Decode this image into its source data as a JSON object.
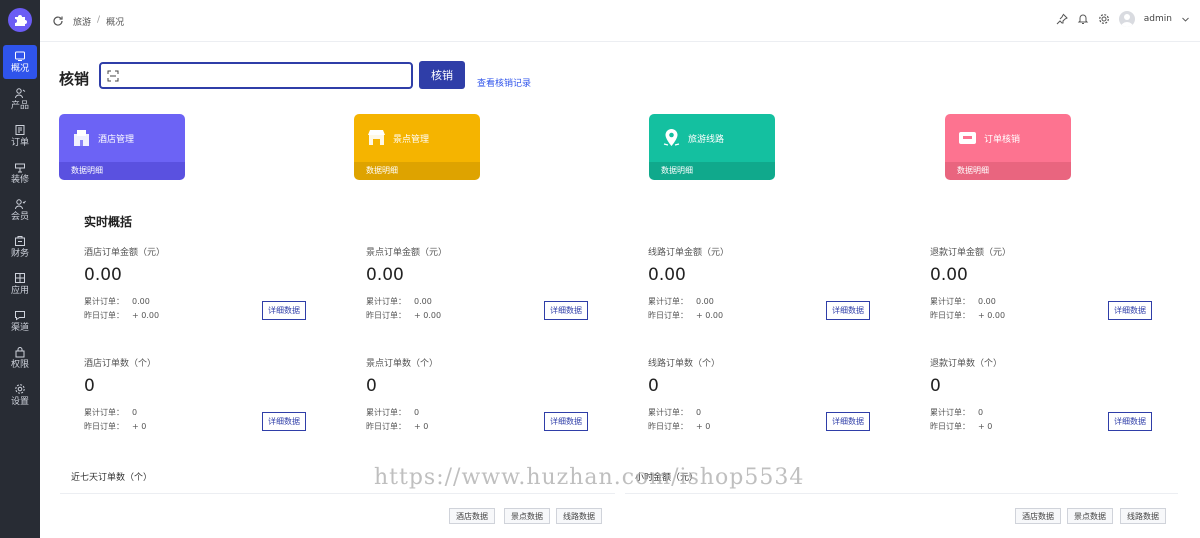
{
  "sidebar": {
    "items": [
      {
        "label": "概况",
        "icon": "dashboard-icon",
        "active": true
      },
      {
        "label": "产品",
        "icon": "product-icon"
      },
      {
        "label": "订单",
        "icon": "order-icon"
      },
      {
        "label": "装修",
        "icon": "decorate-icon"
      },
      {
        "label": "会员",
        "icon": "member-icon"
      },
      {
        "label": "财务",
        "icon": "finance-icon"
      },
      {
        "label": "应用",
        "icon": "apps-icon"
      },
      {
        "label": "渠道",
        "icon": "channel-icon"
      },
      {
        "label": "权限",
        "icon": "lock-icon"
      },
      {
        "label": "设置",
        "icon": "gear-icon"
      }
    ]
  },
  "header": {
    "breadcrumb": [
      "旅游",
      "/",
      "概况"
    ],
    "username": "admin"
  },
  "verify": {
    "title": "核销",
    "input_value": "",
    "button": "核销",
    "link": "查看核销记录"
  },
  "cards": [
    {
      "title": "酒店管理",
      "footer": "数据明细",
      "color": "#6c63f5",
      "foot_color": "#5a51e0",
      "icon": "hotel-icon"
    },
    {
      "title": "景点管理",
      "footer": "数据明细",
      "color": "#f5b400",
      "foot_color": "#dea300",
      "icon": "shop-icon"
    },
    {
      "title": "旅游线路",
      "footer": "数据明细",
      "color": "#14c0a0",
      "foot_color": "#10a98c",
      "icon": "map-pin-icon"
    },
    {
      "title": "订单核销",
      "footer": "数据明细",
      "color": "#fd7390",
      "foot_color": "#e9657f",
      "icon": "ticket-icon"
    }
  ],
  "realtime": {
    "title": "实时概括",
    "detail_button": "详细数据",
    "stats": [
      {
        "label": "酒店订单金额（元）",
        "value": "0.00",
        "k1": "累计订单：",
        "v1": "0.00",
        "k2": "昨日订单：",
        "v2": "+ 0.00"
      },
      {
        "label": "景点订单金额（元）",
        "value": "0.00",
        "k1": "累计订单：",
        "v1": "0.00",
        "k2": "昨日订单：",
        "v2": "+ 0.00"
      },
      {
        "label": "线路订单金额（元）",
        "value": "0.00",
        "k1": "累计订单：",
        "v1": "0.00",
        "k2": "昨日订单：",
        "v2": "+ 0.00"
      },
      {
        "label": "退款订单金额（元）",
        "value": "0.00",
        "k1": "累计订单：",
        "v1": "0.00",
        "k2": "昨日订单：",
        "v2": "+ 0.00"
      },
      {
        "label": "酒店订单数（个）",
        "value": "0",
        "k1": "累计订单：",
        "v1": "0",
        "k2": "昨日订单：",
        "v2": "+ 0"
      },
      {
        "label": "景点订单数（个）",
        "value": "0",
        "k1": "累计订单：",
        "v1": "0",
        "k2": "昨日订单：",
        "v2": "+ 0"
      },
      {
        "label": "线路订单数（个）",
        "value": "0",
        "k1": "累计订单：",
        "v1": "0",
        "k2": "昨日订单：",
        "v2": "+ 0"
      },
      {
        "label": "退款订单数（个）",
        "value": "0",
        "k1": "累计订单：",
        "v1": "0",
        "k2": "昨日订单：",
        "v2": "+ 0"
      }
    ]
  },
  "bottom": {
    "left_title": "近七天订单数（个）",
    "right_title": "小时金额（元）",
    "tabs": [
      "酒店数据",
      "景点数据",
      "线路数据"
    ]
  },
  "watermark": "https://www.huzhan.com/ishop5534"
}
